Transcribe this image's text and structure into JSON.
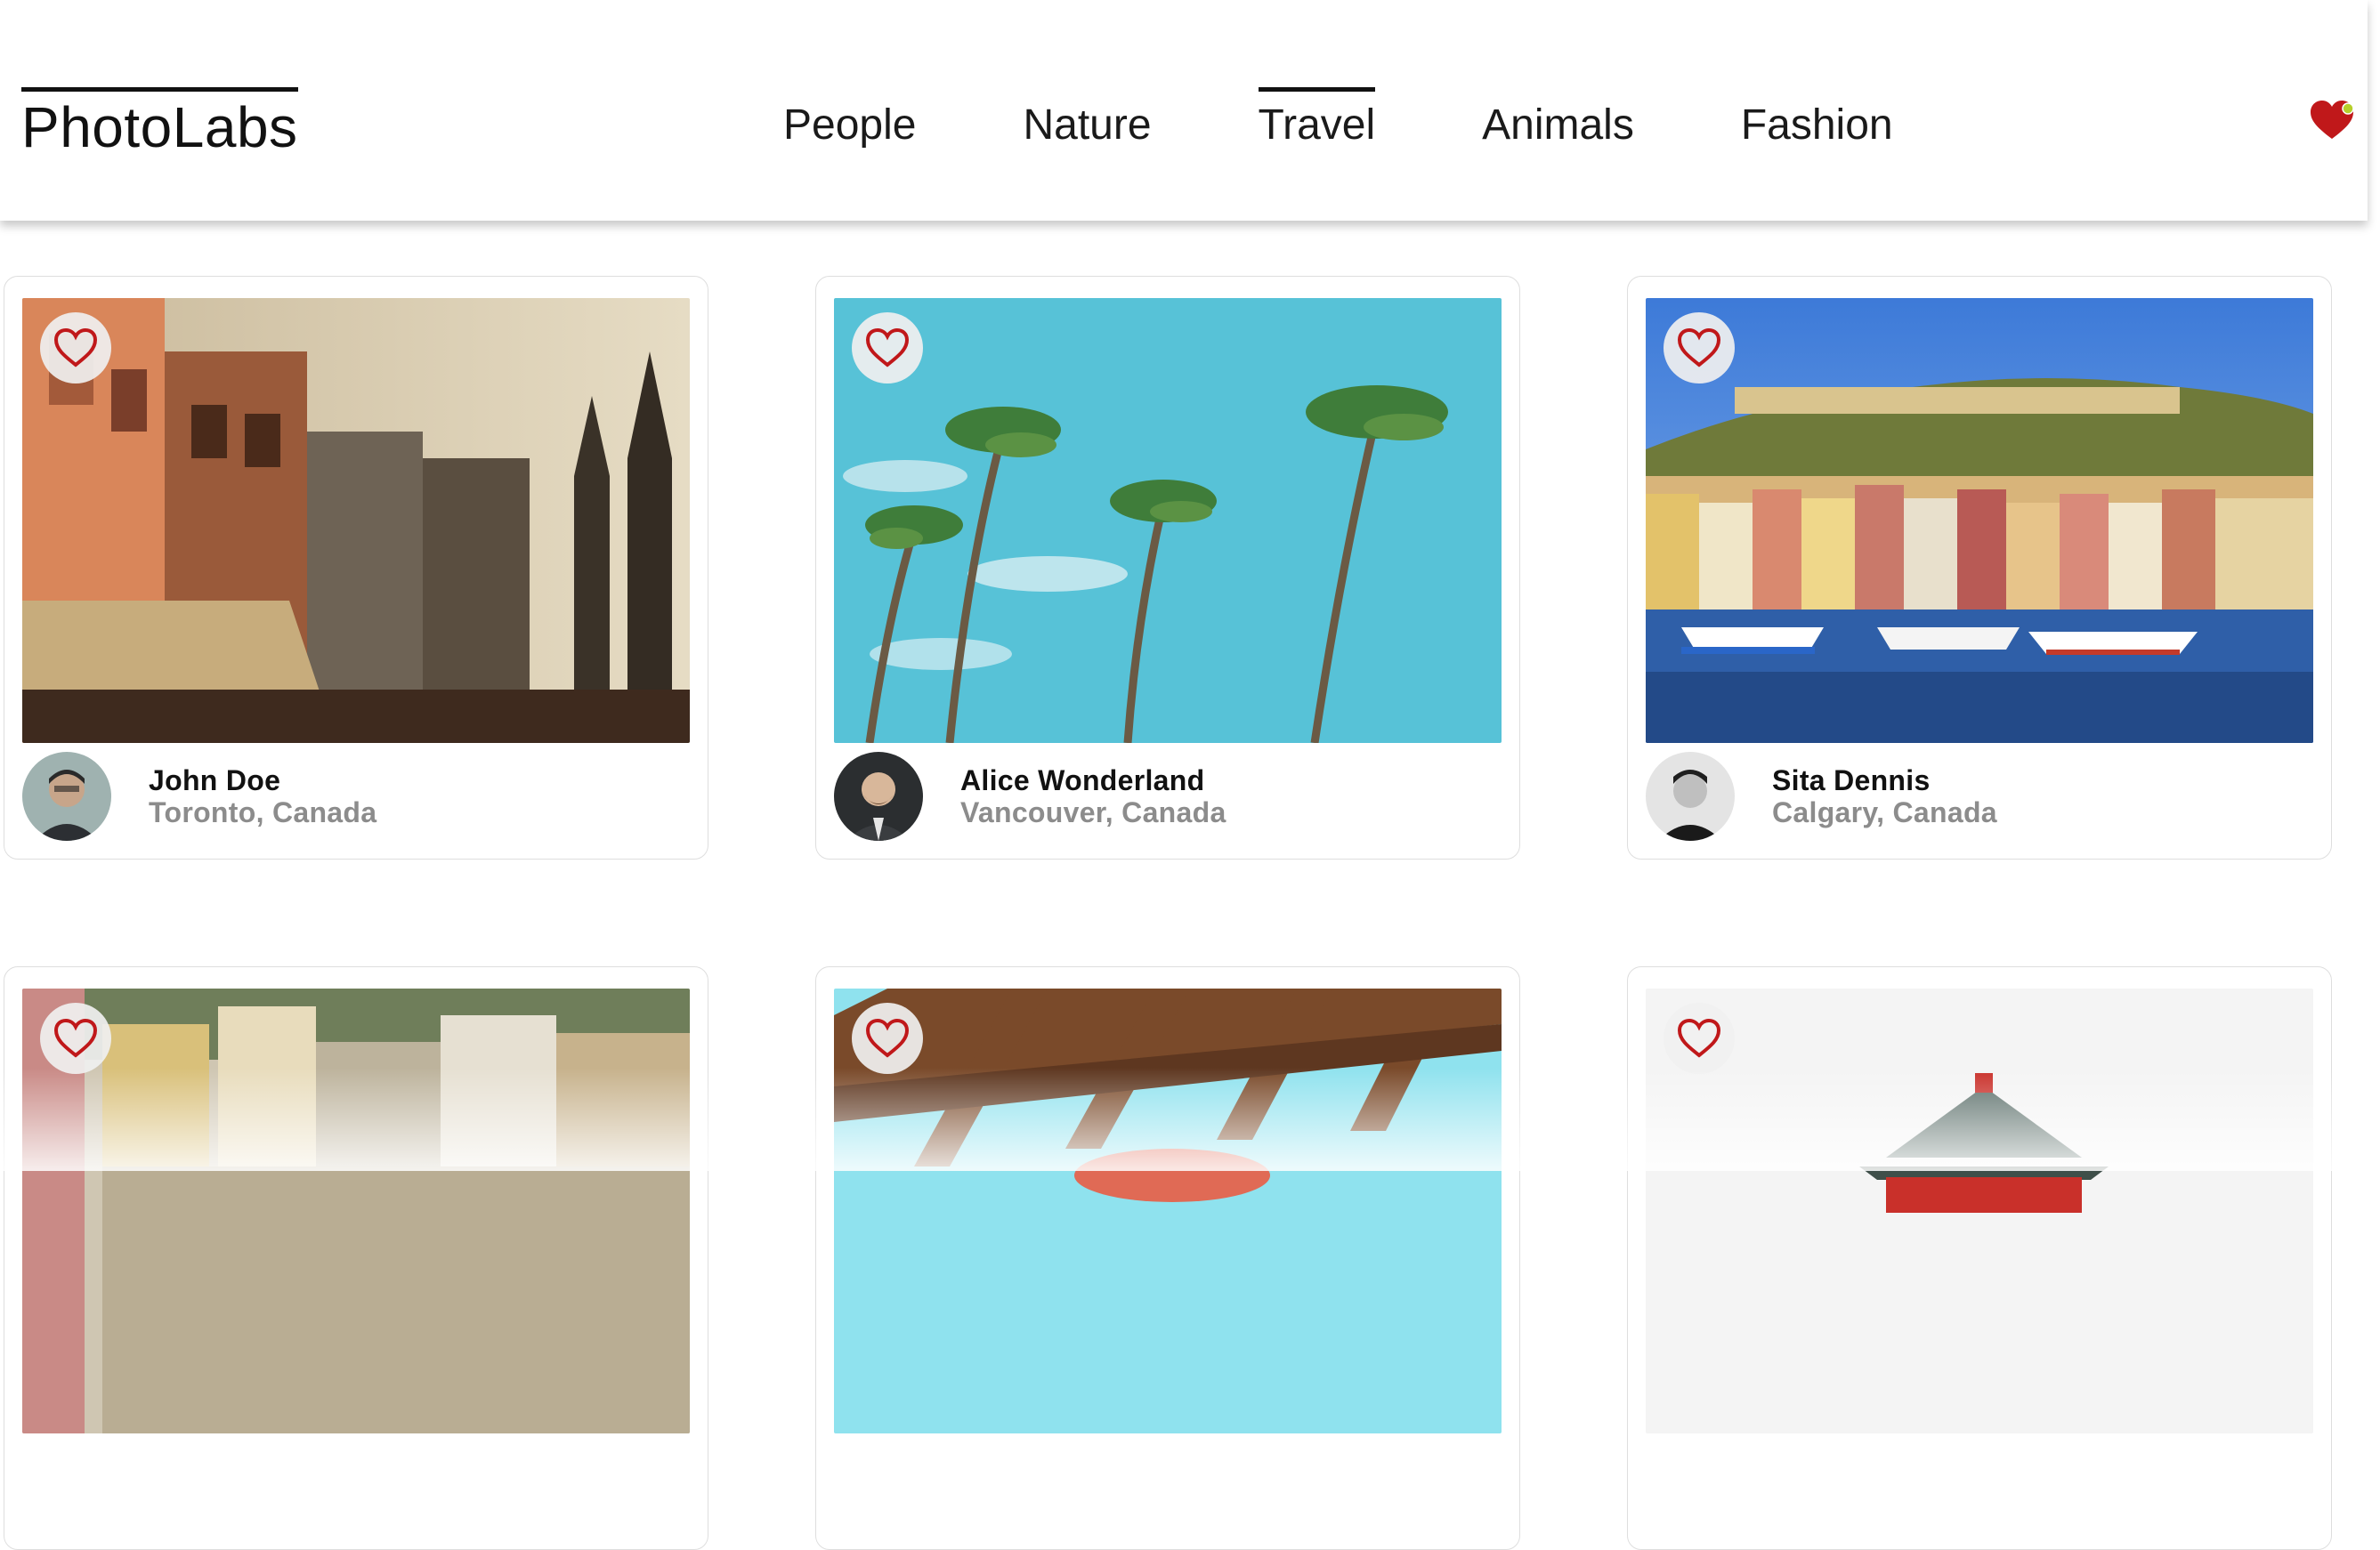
{
  "app": {
    "title": "PhotoLabs"
  },
  "nav": {
    "topics": [
      {
        "label": "People",
        "active": false
      },
      {
        "label": "Nature",
        "active": false
      },
      {
        "label": "Travel",
        "active": true
      },
      {
        "label": "Animals",
        "active": false
      },
      {
        "label": "Fashion",
        "active": false
      }
    ],
    "favorite_icon": "heart-filled-icon",
    "favorite_has_notification": true
  },
  "colors": {
    "heart": "#c0181a",
    "notification_dot": "#b6cf2a",
    "location_text": "#8c8c8c"
  },
  "photos": [
    {
      "user": "John Doe",
      "location": "Toronto, Canada",
      "scene": "old-town-buildings",
      "liked": false
    },
    {
      "user": "Alice Wonderland",
      "location": "Vancouver, Canada",
      "scene": "palm-trees-sky",
      "liked": false
    },
    {
      "user": "Sita Dennis",
      "location": "Calgary, Canada",
      "scene": "harbor-village",
      "liked": false
    },
    {
      "user": "",
      "location": "",
      "scene": "hillside-houses",
      "liked": false
    },
    {
      "user": "",
      "location": "",
      "scene": "pergola-sky",
      "liked": false
    },
    {
      "user": "",
      "location": "",
      "scene": "pagoda-roof",
      "liked": false
    }
  ]
}
